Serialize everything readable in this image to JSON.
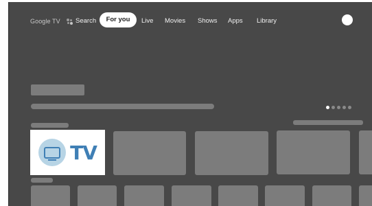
{
  "nav": {
    "brand": "Google TV",
    "search_label": "Search",
    "tabs": [
      {
        "label": "For you",
        "selected": true
      },
      {
        "label": "Live"
      },
      {
        "label": "Movies"
      },
      {
        "label": "Shows"
      },
      {
        "label": "Apps"
      },
      {
        "label": "Library"
      }
    ],
    "icons": {
      "search": "voice-search-icon",
      "avatar": "profile-avatar"
    }
  },
  "carousel": {
    "page_count": 5,
    "active_page": 1
  },
  "logo_card": {
    "text": "TV",
    "icon": "tv-logo-icon",
    "accent_color": "#3f7fb5"
  },
  "colors": {
    "background": "#484848",
    "placeholder": "#7c7c7c",
    "pill": "#ffffff"
  }
}
